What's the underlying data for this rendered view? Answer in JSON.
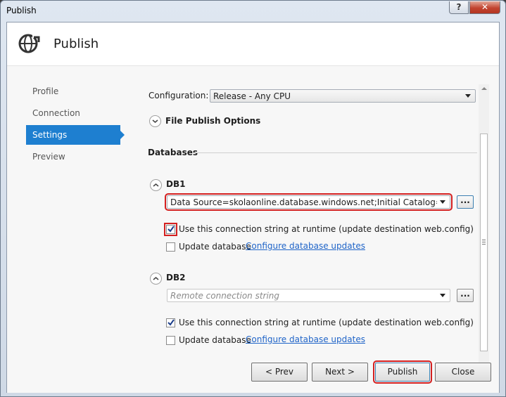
{
  "window": {
    "title": "Publish",
    "help_label": "?",
    "close_label": "✕"
  },
  "header": {
    "title": "Publish",
    "icon": "globe-publish-icon"
  },
  "nav": {
    "items": [
      {
        "label": "Profile"
      },
      {
        "label": "Connection"
      },
      {
        "label": "Settings",
        "active": true
      },
      {
        "label": "Preview"
      }
    ]
  },
  "settings": {
    "configuration_label": "Configuration:",
    "configuration_value": "Release - Any CPU",
    "file_publish_options": "File Publish Options",
    "databases_heading": "Databases",
    "db1": {
      "name": "DB1",
      "connection_string": "Data Source=skolaonline.database.windows.net;Initial Catalog=VYV_NEV",
      "use_runtime_label": "Use this connection string at runtime (update destination web.config)",
      "use_runtime_checked": true,
      "update_db_label": "Update database",
      "update_db_checked": false,
      "configure_link": "Configure database updates",
      "browse_label": "..."
    },
    "db2": {
      "name": "DB2",
      "connection_placeholder": "Remote connection string",
      "use_runtime_label": "Use this connection string at runtime (update destination web.config)",
      "use_runtime_checked": true,
      "update_db_label": "Update database",
      "update_db_checked": false,
      "configure_link": "Configure database updates",
      "browse_label": "..."
    }
  },
  "buttons": {
    "prev": "< Prev",
    "next": "Next >",
    "publish": "Publish",
    "close": "Close"
  },
  "colors": {
    "accent": "#1e7fd0",
    "highlight": "#d42020",
    "link": "#1f64c8"
  }
}
